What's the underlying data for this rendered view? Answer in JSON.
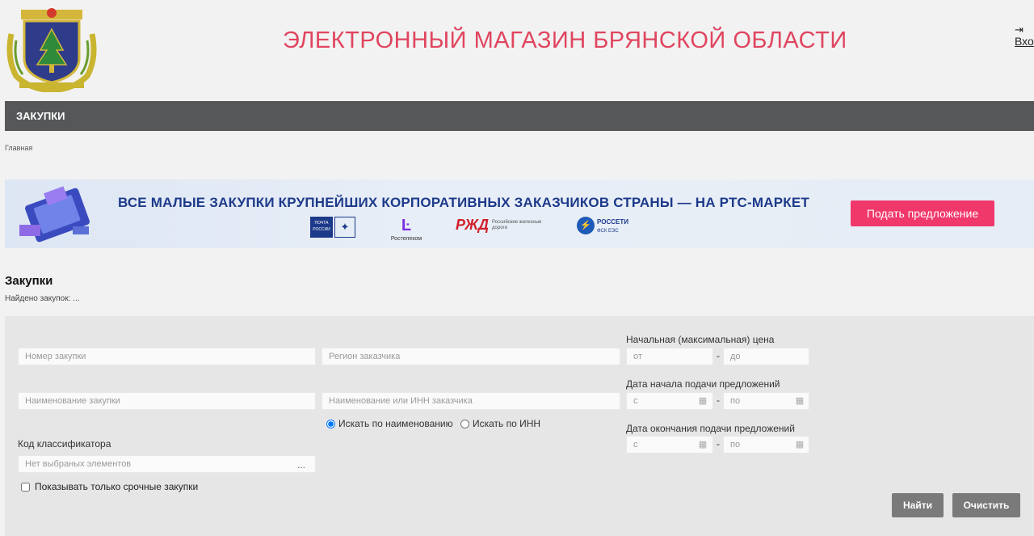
{
  "header": {
    "title": "ЭЛЕКТРОННЫЙ МАГАЗИН БРЯНСКОЙ ОБЛАСТИ",
    "login_label": "Вхо",
    "login_icon": "login-icon"
  },
  "nav": {
    "items": [
      {
        "label": "ЗАКУПКИ"
      }
    ]
  },
  "breadcrumb": {
    "home": "Главная"
  },
  "banner": {
    "title": "ВСЕ МАЛЫЕ ЗАКУПКИ КРУПНЕЙШИХ КОРПОРАТИВНЫХ ЗАКАЗЧИКОВ СТРАНЫ — НА РТС-МАРКЕТ",
    "button": "Подать предложение",
    "partners": {
      "pochta": "ПОЧТА РОССИИ",
      "rostelecom": "Ростелеком",
      "rzd_mark": "РЖД",
      "rzd_name": "Российские железные дороги",
      "rosseti": "РОССЕТИ",
      "rosseti_sub": "ФСК ЕЭС"
    },
    "colors": {
      "button": "#f0386b",
      "title": "#1d3a8a"
    }
  },
  "section": {
    "title": "Закупки",
    "found": "Найдено закупок: ..."
  },
  "filters": {
    "purchase_number_ph": "Номер закупки",
    "customer_region_ph": "Регион заказчика",
    "purchase_name_ph": "Наименование закупки",
    "customer_name_ph": "Наименование или ИНН заказчика",
    "search_by_name": "Искать по наименованию",
    "search_by_inn": "Искать по ИНН",
    "classifier_label": "Код классификатора",
    "classifier_ph": "Нет выбраных элементов",
    "classifier_more": "...",
    "urgent_only": "Показывать только срочные закупки",
    "price_label": "Начальная (максимальная) цена",
    "price_from_ph": "от",
    "price_to_ph": "до",
    "start_date_label": "Дата начала подачи предложений",
    "end_date_label": "Дата окончания подачи предложений",
    "date_from_ph": "с",
    "date_to_ph": "по",
    "range_dash": "-",
    "calendar_icon": "calendar-icon"
  },
  "buttons": {
    "find": "Найти",
    "clear": "Очистить"
  },
  "colors": {
    "title": "#e0455f",
    "navbar": "#555759",
    "button": "#7a7a7a"
  }
}
